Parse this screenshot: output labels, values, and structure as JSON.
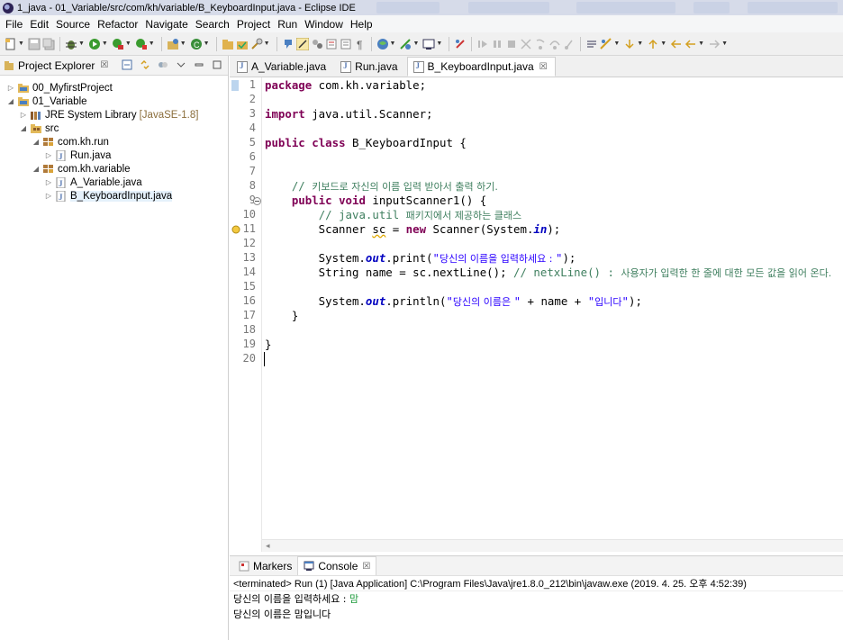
{
  "window": {
    "title": "1_java - 01_Variable/src/com/kh/variable/B_KeyboardInput.java - Eclipse IDE"
  },
  "menubar": {
    "items": [
      "File",
      "Edit",
      "Source",
      "Refactor",
      "Navigate",
      "Search",
      "Project",
      "Run",
      "Window",
      "Help"
    ]
  },
  "project_explorer": {
    "tab_label": "Project Explorer",
    "close_symbol": "☒",
    "tree": [
      {
        "label": "00_MyfirstProject",
        "suffix": "",
        "icon": "project-folder-icon",
        "twist": "▷"
      },
      {
        "label": "01_Variable",
        "suffix": "",
        "icon": "project-folder-icon",
        "twist": "◢"
      },
      {
        "label": "JRE System Library",
        "suffix": "[JavaSE-1.8]",
        "icon": "library-icon",
        "twist": "▷"
      },
      {
        "label": "src",
        "suffix": "",
        "icon": "source-folder-icon",
        "twist": "◢"
      },
      {
        "label": "com.kh.run",
        "suffix": "",
        "icon": "package-icon",
        "twist": "◢"
      },
      {
        "label": "Run.java",
        "suffix": "",
        "icon": "java-file-icon",
        "twist": "▷"
      },
      {
        "label": "com.kh.variable",
        "suffix": "",
        "icon": "package-icon",
        "twist": "◢"
      },
      {
        "label": "A_Variable.java",
        "suffix": "",
        "icon": "java-file-icon",
        "twist": "▷"
      },
      {
        "label": "B_KeyboardInput.java",
        "suffix": "",
        "icon": "java-file-icon",
        "twist": "▷",
        "selected": true
      }
    ]
  },
  "editor": {
    "tabs": [
      {
        "label": "A_Variable.java",
        "active": false
      },
      {
        "label": "Run.java",
        "active": false
      },
      {
        "label": "B_KeyboardInput.java",
        "active": true
      }
    ],
    "close_symbol": "☒",
    "line_numbers": [
      "1",
      "2",
      "3",
      "4",
      "5",
      "6",
      "7",
      "8",
      "9",
      "10",
      "11",
      "12",
      "13",
      "14",
      "15",
      "16",
      "17",
      "18",
      "19",
      "20"
    ],
    "lines": [
      [
        {
          "t": "package",
          "c": "kw"
        },
        {
          "t": " com.kh.variable;"
        }
      ],
      [],
      [
        {
          "t": "import",
          "c": "kw"
        },
        {
          "t": " java.util.Scanner;"
        }
      ],
      [],
      [
        {
          "t": "public",
          "c": "kw"
        },
        {
          "t": " "
        },
        {
          "t": "class",
          "c": "kw"
        },
        {
          "t": " B_KeyboardInput {"
        }
      ],
      [],
      [],
      [
        {
          "t": "    "
        },
        {
          "t": "// ",
          "c": "cm"
        },
        {
          "t": "키보드로 자신의 이름 입력 받아서 출력 하기.",
          "c": "cm ko"
        }
      ],
      [
        {
          "t": "    "
        },
        {
          "t": "public",
          "c": "kw"
        },
        {
          "t": " "
        },
        {
          "t": "void",
          "c": "kw"
        },
        {
          "t": " inputScanner1() {"
        }
      ],
      [
        {
          "t": "        "
        },
        {
          "t": "// java.util ",
          "c": "cm"
        },
        {
          "t": "패키지에서 제공하는 클래스",
          "c": "cm ko"
        }
      ],
      [
        {
          "t": "        Scanner "
        },
        {
          "t": "sc",
          "c": "var-warn"
        },
        {
          "t": " = "
        },
        {
          "t": "new",
          "c": "kw"
        },
        {
          "t": " Scanner(System."
        },
        {
          "t": "in",
          "c": "fld"
        },
        {
          "t": ");"
        }
      ],
      [],
      [
        {
          "t": "        System."
        },
        {
          "t": "out",
          "c": "fld"
        },
        {
          "t": ".print("
        },
        {
          "t": "\"",
          "c": "str"
        },
        {
          "t": "당신의 이름을 입력하세요 : ",
          "c": "str ko"
        },
        {
          "t": "\"",
          "c": "str"
        },
        {
          "t": ");"
        }
      ],
      [
        {
          "t": "        String name = sc.nextLine(); "
        },
        {
          "t": "// netxLine() : ",
          "c": "cm"
        },
        {
          "t": "사용자가 입력한 한 줄에 대한 모든 값을 읽어 온다.",
          "c": "cm ko"
        }
      ],
      [],
      [
        {
          "t": "        System."
        },
        {
          "t": "out",
          "c": "fld"
        },
        {
          "t": ".println("
        },
        {
          "t": "\"",
          "c": "str"
        },
        {
          "t": "당신의 이름은 ",
          "c": "str ko"
        },
        {
          "t": "\"",
          "c": "str"
        },
        {
          "t": " + name + "
        },
        {
          "t": "\"",
          "c": "str"
        },
        {
          "t": "입니다",
          "c": "str ko"
        },
        {
          "t": "\"",
          "c": "str"
        },
        {
          "t": ");"
        }
      ],
      [
        {
          "t": "    }"
        }
      ],
      [],
      [
        {
          "t": "}"
        }
      ],
      []
    ]
  },
  "console": {
    "tabs": [
      {
        "label": "Markers",
        "active": false
      },
      {
        "label": "Console",
        "active": true
      }
    ],
    "close_symbol": "☒",
    "status": "<terminated> Run (1) [Java Application] C:\\Program Files\\Java\\jre1.8.0_212\\bin\\javaw.exe (2019. 4. 25. 오후 4:52:39)",
    "output": [
      {
        "prompt": "당신의 이름을 입력하세요 : ",
        "input": "맘"
      },
      {
        "prompt": "당신의 이름은 맘입니다",
        "input": ""
      }
    ]
  },
  "colors": {
    "keyword": "#7f0055",
    "comment": "#3f7f5f",
    "string": "#2a00ff",
    "field": "#0000c0",
    "console_input": "#1e9b3c"
  }
}
